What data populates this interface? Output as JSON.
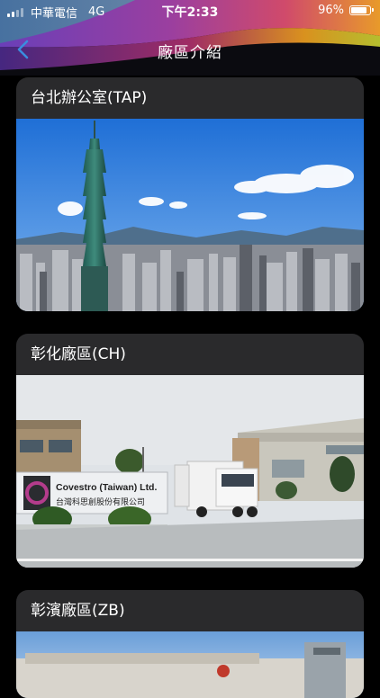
{
  "status_bar": {
    "carrier": "中華電信",
    "network": "4G",
    "time": "下午2:33",
    "battery": "96%",
    "battery_level": 0.96
  },
  "nav": {
    "title": "廠區介紹",
    "back_icon": "chevron-left-icon"
  },
  "colors": {
    "accent": "#3a8dde",
    "card_bg": "#2a2a2c",
    "page_bg": "#000000"
  },
  "sites": [
    {
      "name": "台北辦公室(TAP)"
    },
    {
      "name": "彰化廠區(CH)",
      "sign_en": "Covestro (Taiwan) Ltd.",
      "sign_zh": "台灣科思創股份有限公司"
    },
    {
      "name": "彰濱廠區(ZB)"
    }
  ]
}
